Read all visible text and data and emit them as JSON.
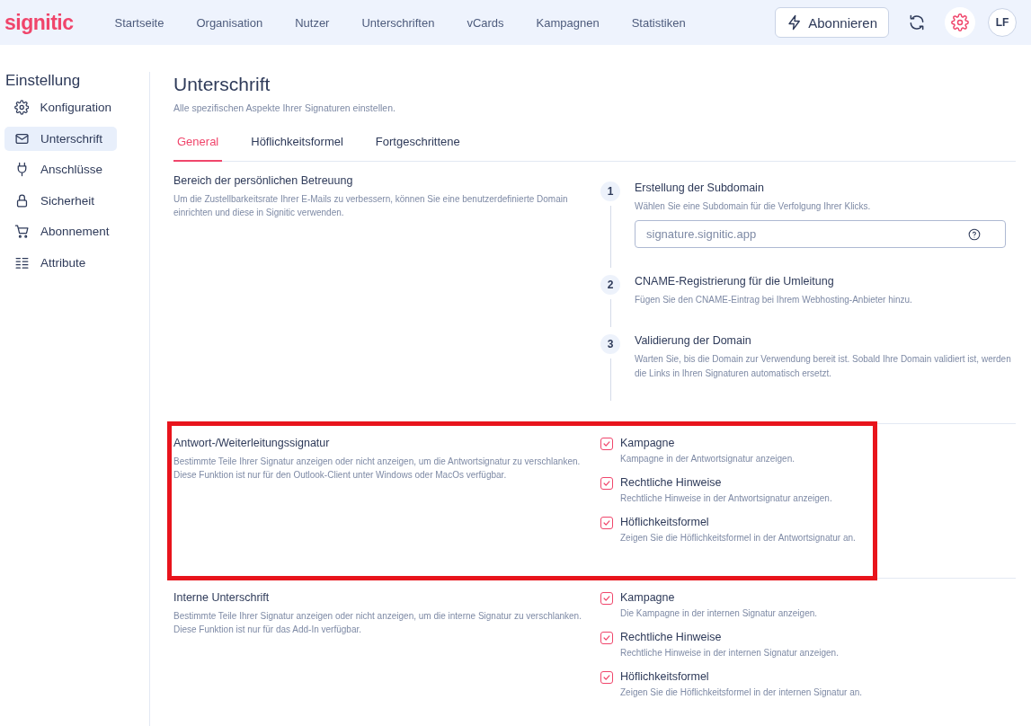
{
  "header": {
    "logo": "signitic",
    "nav": [
      {
        "label": "Startseite"
      },
      {
        "label": "Organisation"
      },
      {
        "label": "Nutzer"
      },
      {
        "label": "Unterschriften"
      },
      {
        "label": "vCards"
      },
      {
        "label": "Kampagnen"
      },
      {
        "label": "Statistiken"
      }
    ],
    "subscribe_button": "Abonnieren",
    "avatar": "LF"
  },
  "sidebar": {
    "title": "Einstellung",
    "items": [
      {
        "label": "Konfiguration",
        "selected": false
      },
      {
        "label": "Unterschrift",
        "selected": true
      },
      {
        "label": "Anschlüsse",
        "selected": false
      },
      {
        "label": "Sicherheit",
        "selected": false
      },
      {
        "label": "Abonnement",
        "selected": false
      },
      {
        "label": "Attribute",
        "selected": false
      }
    ]
  },
  "page": {
    "title": "Unterschrift",
    "subtitle": "Alle spezifischen Aspekte Ihrer Signaturen einstellen.",
    "tabs": [
      {
        "label": "General",
        "selected": true
      },
      {
        "label": "Höflichkeitsformel",
        "selected": false
      },
      {
        "label": "Fortgeschrittene",
        "selected": false
      }
    ]
  },
  "sections": [
    {
      "kind": "steps",
      "title": "Bereich der persönlichen Betreuung",
      "description": "Um die Zustellbarkeitsrate Ihrer E-Mails zu verbessern, können Sie eine benutzerdefinierte Domain einrichten und diese in Signitic verwenden.",
      "highlighted": false,
      "steps": [
        {
          "number": "1",
          "title": "Erstellung der Subdomain",
          "description": "Wählen Sie eine Subdomain für die Verfolgung Ihrer Klicks.",
          "field": {
            "placeholder": "signature.signitic.app"
          }
        },
        {
          "number": "2",
          "title": "CNAME-Registrierung für die Umleitung",
          "description": "Fügen Sie den CNAME-Eintrag bei Ihrem Webhosting-Anbieter hinzu."
        },
        {
          "number": "3",
          "title": "Validierung der Domain",
          "description": "Warten Sie, bis die Domain zur Verwendung bereit ist. Sobald Ihre Domain validiert ist, werden die Links in Ihren Signaturen automatisch ersetzt."
        }
      ]
    },
    {
      "kind": "checkboxes",
      "title": "Antwort-/Weiterleitungssignatur",
      "description": "Bestimmte Teile Ihrer Signatur anzeigen oder nicht anzeigen, um die Antwortsignatur zu verschlanken. Diese Funktion ist nur für den Outlook-Client unter Windows oder MacOs verfügbar.",
      "highlighted": true,
      "options": [
        {
          "label": "Kampagne",
          "description": "Kampagne in der Antwortsignatur anzeigen.",
          "checked": true
        },
        {
          "label": "Rechtliche Hinweise",
          "description": "Rechtliche Hinweise in der Antwortsignatur anzeigen.",
          "checked": true
        },
        {
          "label": "Höflichkeitsformel",
          "description": "Zeigen Sie die Höflichkeitsformel in der Antwortsignatur an.",
          "checked": true
        }
      ]
    },
    {
      "kind": "checkboxes",
      "title": "Interne Unterschrift",
      "description": "Bestimmte Teile Ihrer Signatur anzeigen oder nicht anzeigen, um die interne Signatur zu verschlanken. Diese Funktion ist nur für das Add-In verfügbar.",
      "highlighted": false,
      "options": [
        {
          "label": "Kampagne",
          "description": "Die Kampagne in der internen Signatur anzeigen.",
          "checked": true
        },
        {
          "label": "Rechtliche Hinweise",
          "description": "Rechtliche Hinweise in der internen Signatur anzeigen.",
          "checked": true
        },
        {
          "label": "Höflichkeitsformel",
          "description": "Zeigen Sie die Höflichkeitsformel in der internen Signatur an.",
          "checked": true
        }
      ]
    }
  ]
}
